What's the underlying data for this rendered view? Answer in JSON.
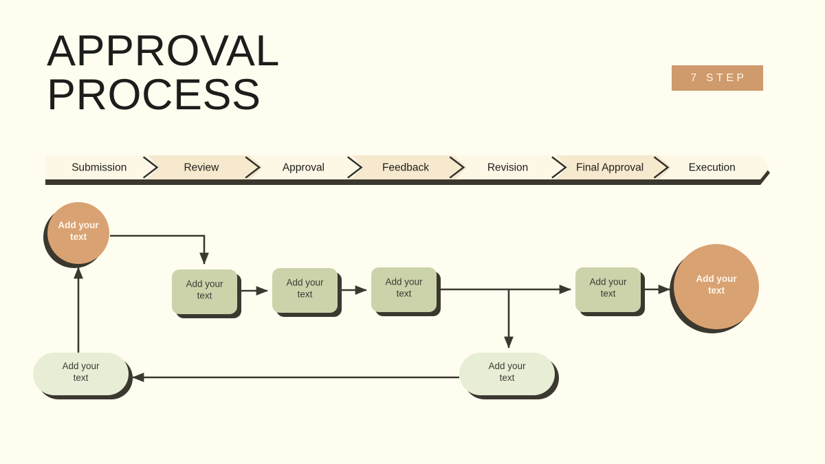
{
  "slide": {
    "background_color": "#fffdf0",
    "title": "APPROVAL\nPROCESS",
    "badge_label": "7 STEP"
  },
  "palette": {
    "background": "#fffdf0",
    "title_text": "#1d1d1b",
    "badge_fill": "#cf9a6c",
    "badge_text": "#fdf6ea",
    "bar_light": "#fdf7e6",
    "bar_dark": "#f7e9ce",
    "bar_shadow": "#3b382f",
    "chevron_stroke": "#2f2d27",
    "node_green": "#ccd3ab",
    "node_green_light": "#e8eed6",
    "node_tan": "#d9a273",
    "node_shadow": "#3b382f",
    "connector": "#3b382f",
    "node_text_dark": "#3b3b33",
    "node_text_light": "#fdf6ea"
  },
  "stage_bar": {
    "name": "process-stage-bar",
    "stages": [
      {
        "label": "Submission",
        "tone": "light"
      },
      {
        "label": "Review",
        "tone": "dark"
      },
      {
        "label": "Approval",
        "tone": "light"
      },
      {
        "label": "Feedback",
        "tone": "dark"
      },
      {
        "label": "Revision",
        "tone": "light"
      },
      {
        "label": "Final Approval",
        "tone": "dark"
      },
      {
        "label": "Execution",
        "tone": "light"
      }
    ]
  },
  "flow": {
    "placeholder_text_line1": "Add your",
    "placeholder_text_line2": "text",
    "nodes": [
      {
        "id": "start-circle",
        "shape": "circle",
        "fill": "tan",
        "text": "Add your text"
      },
      {
        "id": "step-box-1",
        "shape": "rounded-rect",
        "fill": "green",
        "text": "Add your text"
      },
      {
        "id": "step-box-2",
        "shape": "rounded-rect",
        "fill": "green",
        "text": "Add your text"
      },
      {
        "id": "step-box-3",
        "shape": "rounded-rect",
        "fill": "green",
        "text": "Add your text"
      },
      {
        "id": "step-box-4",
        "shape": "rounded-rect",
        "fill": "green",
        "text": "Add your text"
      },
      {
        "id": "end-circle",
        "shape": "circle",
        "fill": "tan",
        "text": "Add your text"
      },
      {
        "id": "branch-pill",
        "shape": "pill",
        "fill": "green-light",
        "text": "Add your text"
      },
      {
        "id": "loopback-pill",
        "shape": "pill",
        "fill": "green-light",
        "text": "Add your text"
      }
    ],
    "connectors": [
      {
        "from": "start-circle",
        "to": "step-box-1",
        "style": "elbow-right-down"
      },
      {
        "from": "step-box-1",
        "to": "step-box-2",
        "style": "straight-right"
      },
      {
        "from": "step-box-2",
        "to": "step-box-3",
        "style": "straight-right"
      },
      {
        "from": "step-box-3",
        "to": "step-box-4",
        "style": "straight-right"
      },
      {
        "from": "step-box-3",
        "to": "branch-pill",
        "style": "tee-down"
      },
      {
        "from": "step-box-4",
        "to": "end-circle",
        "style": "straight-right"
      },
      {
        "from": "branch-pill",
        "to": "loopback-pill",
        "style": "straight-left"
      },
      {
        "from": "loopback-pill",
        "to": "start-circle",
        "style": "straight-up"
      }
    ]
  }
}
